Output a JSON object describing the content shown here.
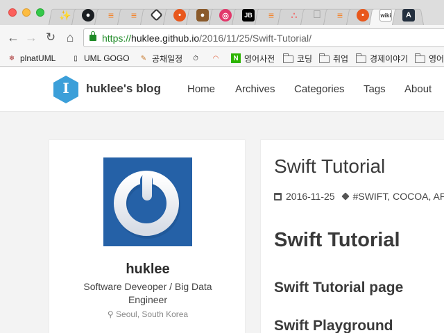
{
  "browser": {
    "tabs": [
      {
        "icon": "magic-wand-icon",
        "glyph": "✨",
        "style": "wand"
      },
      {
        "icon": "github-icon",
        "glyph": "●",
        "style": "gh"
      },
      {
        "icon": "stackoverflow-icon",
        "glyph": "≡",
        "style": "so"
      },
      {
        "icon": "stackoverflow-icon",
        "glyph": "≡",
        "style": "so"
      },
      {
        "icon": "diamond-icon",
        "glyph": "",
        "style": "diamond"
      },
      {
        "icon": "orange-circle-icon",
        "glyph": "•",
        "style": "orange"
      },
      {
        "icon": "ninja-icon",
        "glyph": "●",
        "style": "ninja"
      },
      {
        "icon": "dribbble-icon",
        "glyph": "◎",
        "style": "dribbble"
      },
      {
        "icon": "jetbrains-icon",
        "glyph": "JB",
        "style": "jb"
      },
      {
        "icon": "stackoverflow-icon",
        "glyph": "≡",
        "style": "so"
      },
      {
        "icon": "asana-icon",
        "glyph": "∴",
        "style": "asana"
      },
      {
        "icon": "apple-icon",
        "glyph": "",
        "style": "apple"
      },
      {
        "icon": "stackoverflow-icon",
        "glyph": "≡",
        "style": "so"
      },
      {
        "icon": "orange-circle-icon",
        "glyph": "•",
        "style": "orange"
      },
      {
        "icon": "wikidocs-icon",
        "glyph": "wiki",
        "style": "wiki",
        "active": true
      },
      {
        "icon": "amazon-icon",
        "glyph": "A",
        "style": "amz"
      }
    ],
    "url": {
      "scheme": "https://",
      "host": "huklee.github.io",
      "path": "/2016/11/25/Swift-Tutorial/"
    },
    "bookmarks": [
      {
        "label": "plnatUML",
        "icon": "plantuml-icon"
      },
      {
        "label": "UML GOGO",
        "icon": "page-icon"
      },
      {
        "label": "공채일정",
        "icon": "pencil-icon"
      },
      {
        "label": "",
        "icon": "timer-icon"
      },
      {
        "label": "",
        "icon": "rainbow-icon"
      },
      {
        "label": "영어사전",
        "icon": "naver-icon"
      },
      {
        "label": "코딩",
        "icon": "folder-icon"
      },
      {
        "label": "취업",
        "icon": "folder-icon"
      },
      {
        "label": "경제이야기",
        "icon": "folder-icon"
      },
      {
        "label": "영어",
        "icon": "folder-icon"
      }
    ]
  },
  "site": {
    "brand_letter": "I",
    "brand": "huklee's blog",
    "nav": [
      "Home",
      "Archives",
      "Categories",
      "Tags",
      "About"
    ]
  },
  "profile": {
    "name": "huklee",
    "job": "Software Deveoper / Big Data Engineer",
    "location": "Seoul, South Korea"
  },
  "post": {
    "title": "Swift Tutorial",
    "date": "2016-11-25",
    "tags": "#SWIFT, COCOA, AP",
    "heading1": "Swift Tutorial",
    "heading2": "Swift Tutorial page",
    "heading3": "Swift Playground"
  },
  "colors": {
    "logo": "#3b9fd9",
    "avatar_bg": "#2561a7",
    "secure": "#1e8a26"
  }
}
